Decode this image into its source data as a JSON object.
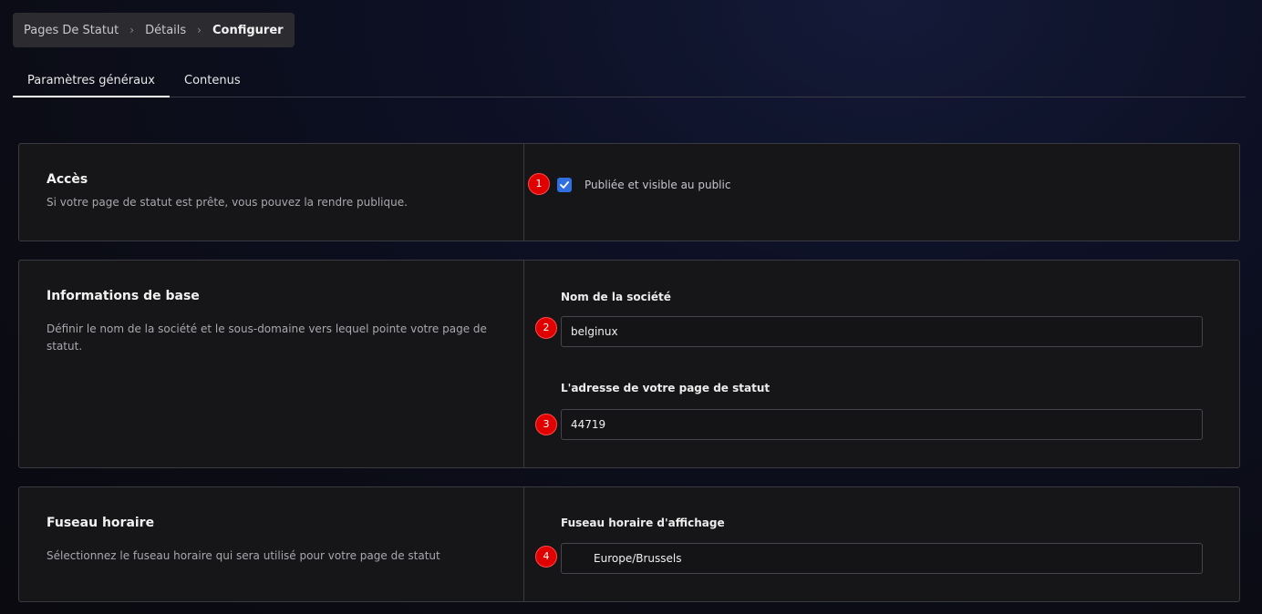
{
  "breadcrumb": {
    "items": [
      "Pages De Statut",
      "Détails"
    ],
    "current": "Configurer"
  },
  "tabs": [
    {
      "label": "Paramètres généraux",
      "active": true
    },
    {
      "label": "Contenus",
      "active": false
    }
  ],
  "sections": {
    "access": {
      "title": "Accès",
      "description": "Si votre page de statut est prête, vous pouvez la rendre publique.",
      "marker": "1",
      "checkbox_label": "Publiée et visible au public",
      "checked": true
    },
    "basic_info": {
      "title": "Informations de base",
      "description": "Définir le nom de la société et le sous-domaine vers lequel pointe votre page de statut.",
      "company_label": "Nom de la société",
      "company_value": "belginux",
      "company_marker": "2",
      "address_label": "L'adresse de votre page de statut",
      "address_value": "44719",
      "address_marker": "3"
    },
    "timezone": {
      "title": "Fuseau horaire",
      "description": "Sélectionnez le fuseau horaire qui sera utilisé pour votre page de statut",
      "field_label": "Fuseau horaire d'affichage",
      "field_value": "Europe/Brussels",
      "marker": "4",
      "icon": "search-icon"
    }
  },
  "colors": {
    "accent": "#2f6fe0",
    "marker": "#e00000"
  }
}
